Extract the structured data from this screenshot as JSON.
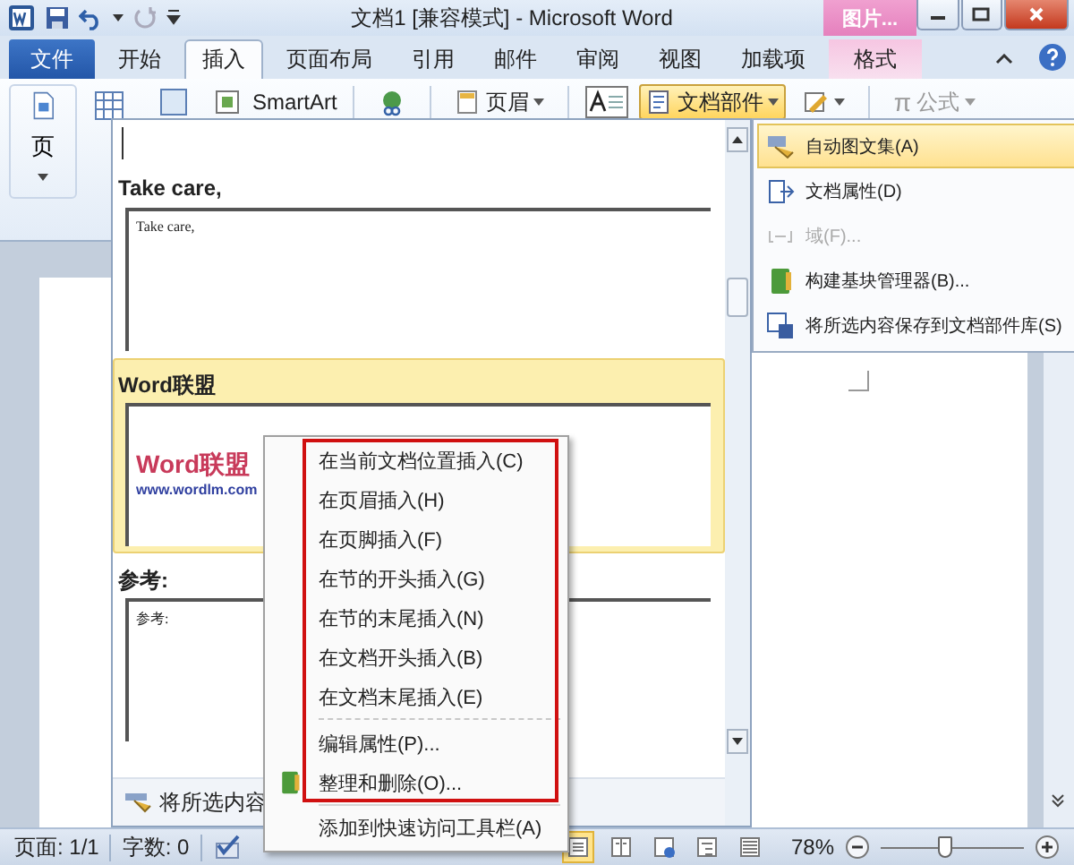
{
  "window": {
    "title": "文档1 [兼容模式] - Microsoft Word",
    "context_group": "图片..."
  },
  "tabs": [
    {
      "label": "文件",
      "kind": "file",
      "selected": false
    },
    {
      "label": "开始",
      "kind": "normal",
      "selected": false
    },
    {
      "label": "插入",
      "kind": "normal",
      "selected": true
    },
    {
      "label": "页面布局",
      "kind": "normal",
      "selected": false
    },
    {
      "label": "引用",
      "kind": "normal",
      "selected": false
    },
    {
      "label": "邮件",
      "kind": "normal",
      "selected": false
    },
    {
      "label": "审阅",
      "kind": "normal",
      "selected": false
    },
    {
      "label": "视图",
      "kind": "normal",
      "selected": false
    },
    {
      "label": "加载项",
      "kind": "normal",
      "selected": false
    },
    {
      "label": "格式",
      "kind": "context",
      "selected": false
    }
  ],
  "ribbon": {
    "page_button": "页",
    "smartart": "SmartArt",
    "header": "页眉",
    "quick_parts": "文档部件",
    "equation_symbol": "π",
    "equation": "公式"
  },
  "quick_parts_menu": [
    {
      "label": "自动图文集(A)",
      "selected": true,
      "disabled": false
    },
    {
      "label": "文档属性(D)",
      "selected": false,
      "disabled": false
    },
    {
      "label": "域(F)...",
      "selected": false,
      "disabled": true
    },
    {
      "label": "构建基块管理器(B)...",
      "selected": false,
      "disabled": false
    },
    {
      "label": "将所选内容保存到文档部件库(S)",
      "selected": false,
      "disabled": false
    }
  ],
  "gallery": {
    "entries": [
      {
        "title": "Take care,",
        "preview_text": "Take care,",
        "selected": false
      },
      {
        "title": "Word联盟",
        "preview_text": "Word联盟",
        "preview_subtext": "www.wordlm.com",
        "selected": true
      },
      {
        "title": "参考:",
        "preview_text": "参考:",
        "selected": false
      }
    ],
    "footer": "将所选内容"
  },
  "context_menu": [
    {
      "label": "在当前文档位置插入(C)",
      "kind": "plain",
      "separator_before": false
    },
    {
      "label": "在页眉插入(H)",
      "kind": "plain",
      "separator_before": false
    },
    {
      "label": "在页脚插入(F)",
      "kind": "plain",
      "separator_before": false
    },
    {
      "label": "在节的开头插入(G)",
      "kind": "plain",
      "separator_before": false
    },
    {
      "label": "在节的末尾插入(N)",
      "kind": "plain",
      "separator_before": false
    },
    {
      "label": "在文档开头插入(B)",
      "kind": "plain",
      "separator_before": false
    },
    {
      "label": "在文档末尾插入(E)",
      "kind": "plain",
      "separator_before": false
    },
    {
      "label": "编辑属性(P)...",
      "kind": "plain",
      "separator_before": true
    },
    {
      "label": "整理和删除(O)...",
      "kind": "iconned",
      "separator_before": false
    },
    {
      "label": "添加到快速访问工具栏(A)",
      "kind": "plain",
      "separator_before": true
    }
  ],
  "status_bar": {
    "page": "页面: 1/1",
    "words": "字数: 0",
    "views": [
      {
        "kind": "print",
        "selected": true
      },
      {
        "kind": "reading",
        "selected": false
      },
      {
        "kind": "web",
        "selected": false
      },
      {
        "kind": "outline",
        "selected": false
      },
      {
        "kind": "draft",
        "selected": false
      }
    ],
    "zoom": "78%",
    "zoom_slider": {
      "level": 0.45
    }
  }
}
